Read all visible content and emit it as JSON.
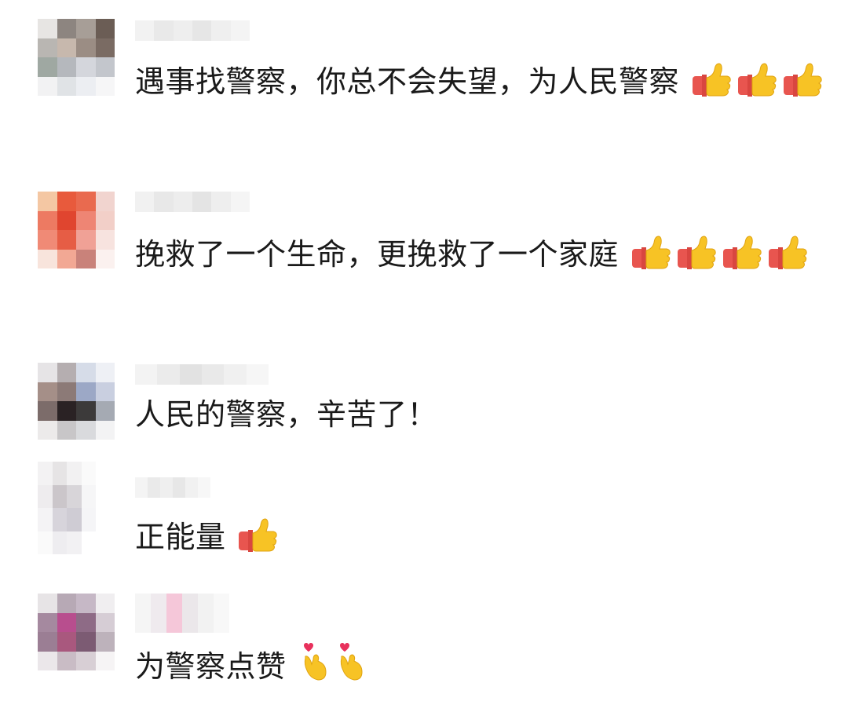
{
  "comments": [
    {
      "text": "遇事找警察，你总不会失望，为人民警察",
      "emoji": "thumbs-up",
      "emoji_count": 3
    },
    {
      "text": "挽救了一个生命，更挽救了一个家庭",
      "emoji": "thumbs-up",
      "emoji_count": 4
    },
    {
      "text": "人民的警察，辛苦了！",
      "emoji": "",
      "emoji_count": 0
    },
    {
      "text": "正能量",
      "emoji": "thumbs-up",
      "emoji_count": 1
    },
    {
      "text": "为警察点赞",
      "emoji": "finger-heart",
      "emoji_count": 2
    }
  ],
  "colors": {
    "text": "#1a1a1a",
    "background": "#ffffff",
    "thumb_yellow": "#f7c325",
    "sleeve_red": "#e8554f"
  }
}
